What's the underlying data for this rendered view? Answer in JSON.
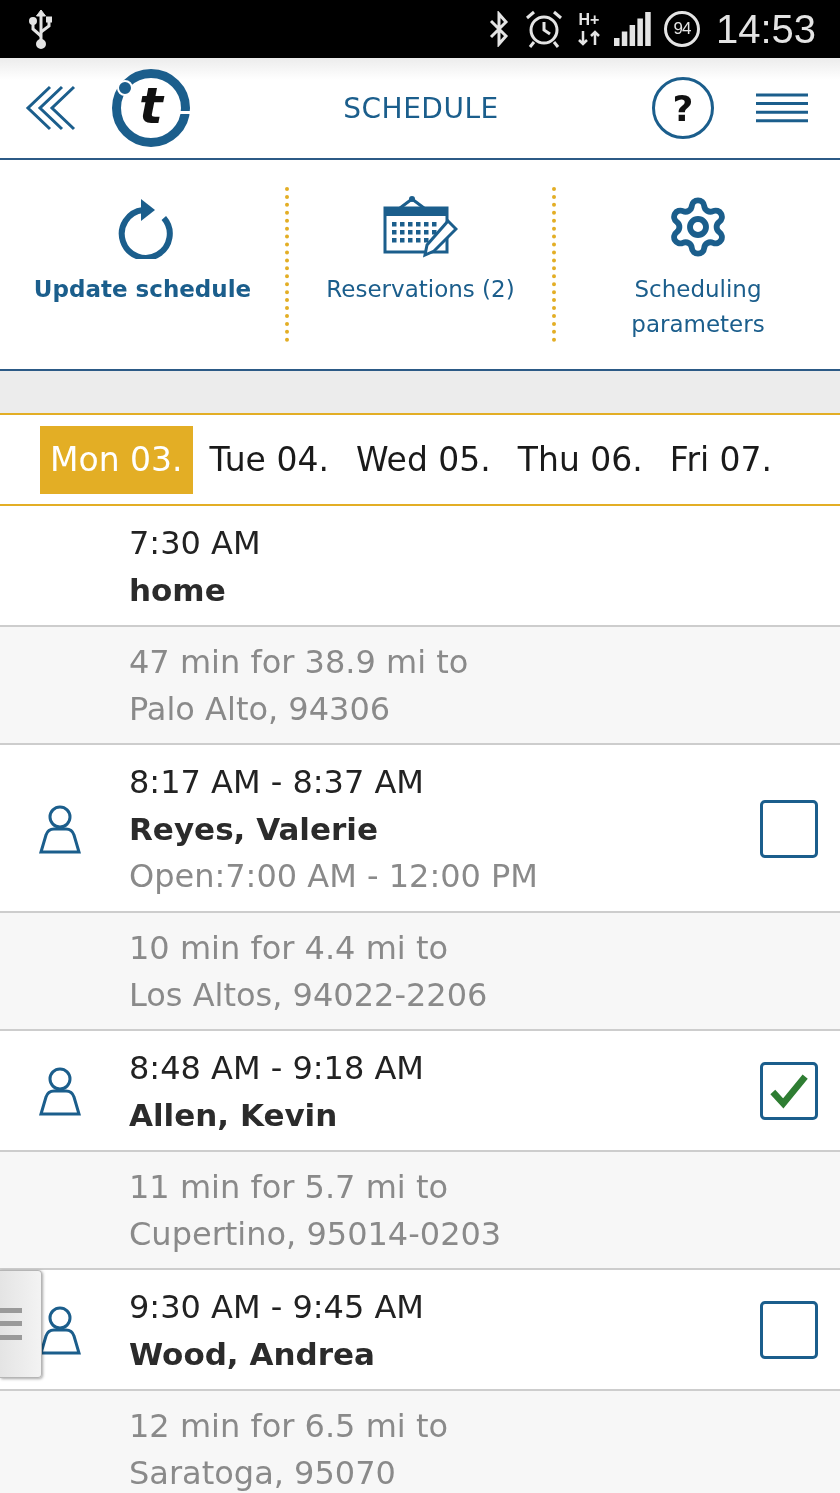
{
  "status_bar": {
    "network": "H+",
    "battery": "94",
    "time": "14:53"
  },
  "header": {
    "logo": "t",
    "title": "SCHEDULE",
    "help": "?"
  },
  "toolbar": [
    {
      "kind": "refresh",
      "label": "Update schedule",
      "highlighted": true
    },
    {
      "kind": "calendar",
      "label": "Reservations (2)",
      "highlighted": false
    },
    {
      "kind": "settings",
      "label": "Scheduling parameters",
      "highlighted": false
    }
  ],
  "days": [
    {
      "label": "Mon 03.",
      "selected": true
    },
    {
      "label": "Tue 04.",
      "selected": false
    },
    {
      "label": "Wed 05.",
      "selected": false
    },
    {
      "label": "Thu 06.",
      "selected": false
    },
    {
      "label": "Fri 07.",
      "selected": false
    }
  ],
  "schedule": [
    {
      "kind": "stop",
      "time": "7:30 AM",
      "name": "home"
    },
    {
      "kind": "travel",
      "summary": "47 min for 38.9 mi to",
      "destination": "Palo Alto, 94306"
    },
    {
      "kind": "visit",
      "time": "8:17 AM - 8:37 AM",
      "name": "Reyes, Valerie",
      "hours": "Open:7:00 AM - 12:00 PM",
      "checked": false
    },
    {
      "kind": "travel",
      "summary": "10 min for 4.4 mi to",
      "destination": "Los Altos, 94022-2206"
    },
    {
      "kind": "visit",
      "time": "8:48 AM - 9:18 AM",
      "name": "Allen, Kevin",
      "checked": true
    },
    {
      "kind": "travel",
      "summary": "11 min for 5.7 mi to",
      "destination": "Cupertino, 95014-0203"
    },
    {
      "kind": "visit",
      "time": "9:30 AM - 9:45 AM",
      "name": "Wood, Andrea",
      "checked": false
    },
    {
      "kind": "travel",
      "summary": "12 min for 6.5 mi to",
      "destination": "Saratoga, 95070"
    }
  ]
}
